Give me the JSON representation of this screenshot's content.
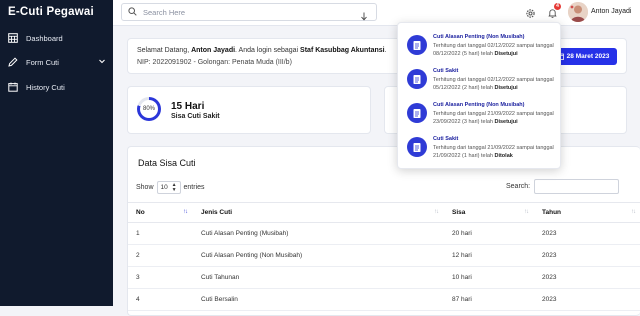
{
  "app": {
    "brand": "E-Cuti Pegawai"
  },
  "sidebar": {
    "items": [
      {
        "label": "Dashboard",
        "icon": "calculator-icon"
      },
      {
        "label": "Form Cuti",
        "icon": "pencil-icon",
        "has_chevron": true
      },
      {
        "label": "History Cuti",
        "icon": "calendar-icon"
      }
    ]
  },
  "topbar": {
    "search_placeholder": "Search Here",
    "notif_count": "4",
    "username": "Anton Jayadi"
  },
  "welcome": {
    "greeting_pre": "Selamat Datang, ",
    "name": "Anton Jayadi",
    "greeting_mid": ". Anda login sebagai ",
    "role": "Staf Kasubbag Akuntansi",
    "greeting_end": ".",
    "nip": "NIP: 2022091902",
    "separator": " - ",
    "golongan": "Golongan: Penata Muda (III/b)",
    "date_button": "28 Maret 2023"
  },
  "stat": {
    "percent_label": "80%",
    "percent_value": 80,
    "value": "15 Hari",
    "label": "Sisa Cuti Sakit"
  },
  "table": {
    "title": "Data Sisa Cuti",
    "show_label": "Show",
    "entries_value": "10",
    "entries_label": "entries",
    "search_label": "Search:",
    "columns": [
      "No",
      "Jenis Cuti",
      "Sisa",
      "Tahun"
    ],
    "rows": [
      [
        "1",
        "Cuti Alasan Penting (Musibah)",
        "20 hari",
        "2023"
      ],
      [
        "2",
        "Cuti Alasan Penting (Non Musibah)",
        "12 hari",
        "2023"
      ],
      [
        "3",
        "Cuti Tahunan",
        "10 hari",
        "2023"
      ],
      [
        "4",
        "Cuti Bersalin",
        "87 hari",
        "2023"
      ]
    ]
  },
  "notifications": [
    {
      "title": "Cuti Alasan Penting (Non Musibah)",
      "text": "Terhitung dari tanggal 02/12/2022 sampai tanggal 08/12/2022 (5 hari) telah ",
      "status": "Disetujui"
    },
    {
      "title": "Cuti Sakit",
      "text": "Terhitung dari tanggal 02/12/2022 sampai tanggal 05/12/2022 (2 hari) telah ",
      "status": "Disetujui"
    },
    {
      "title": "Cuti Alasan Penting (Non Musibah)",
      "text": "Terhitung dari tanggal 21/09/2022 sampai tanggal 23/09/2022 (3 hari) telah ",
      "status": "Disetujui"
    },
    {
      "title": "Cuti Sakit",
      "text": "Terhitung dari tanggal 21/09/2022 sampai tanggal 21/09/2022 (1 hari) telah ",
      "status": "Ditolak"
    }
  ],
  "colors": {
    "sidebar_bg": "#101a2d",
    "accent": "#2631e8",
    "notif_badge": "#e53935"
  }
}
